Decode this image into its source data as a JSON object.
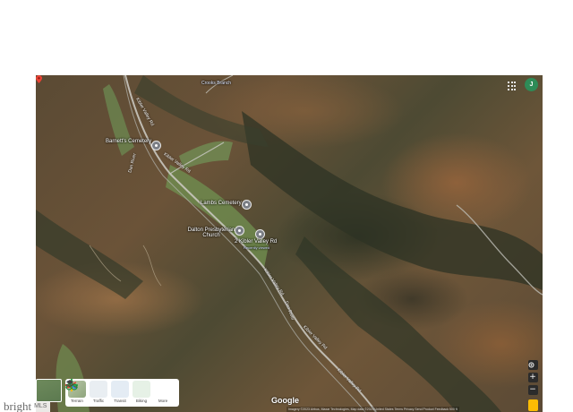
{
  "map": {
    "labels": {
      "barnetts_cemetery": "Barnett's Cemetery",
      "creek": "Crooks Branch",
      "lambs_cemetery": "Lambs Cemetery",
      "presbyterian_church": "Dalton Presbyterian Church",
      "address": "2 Kibler Valley Rd",
      "address_sub": "Recently viewed"
    },
    "road_labels": {
      "r1": "Kibler Valley Rd",
      "r2": "Kibler Valley Rd",
      "r3": "Kibler Valley Rd",
      "r4": "Dan River",
      "r5": "Kibler Valley Rd",
      "r6": "Kibler Valley Rd",
      "r7": "Dan River"
    },
    "marker_color": "#ea4335"
  },
  "header": {
    "avatar_initial": "J",
    "avatar_color": "#2e8b57"
  },
  "layers": {
    "items": [
      {
        "label": "Terrain",
        "icon": "terrain-icon"
      },
      {
        "label": "Traffic",
        "icon": "traffic-icon"
      },
      {
        "label": "Transit",
        "icon": "transit-icon"
      },
      {
        "label": "Biking",
        "icon": "biking-icon"
      },
      {
        "label": "More",
        "icon": "layers-icon"
      }
    ]
  },
  "controls": {
    "zoom_in": "+",
    "zoom_out": "−"
  },
  "footer": {
    "google_logo": "Google",
    "attribution": "Imagery ©2023 Airbus, Maxar Technologies, Map data ©2023   United States   Terms   Privacy   Send Product Feedback   500 ft",
    "brand": "bright",
    "mls": "MLS"
  }
}
